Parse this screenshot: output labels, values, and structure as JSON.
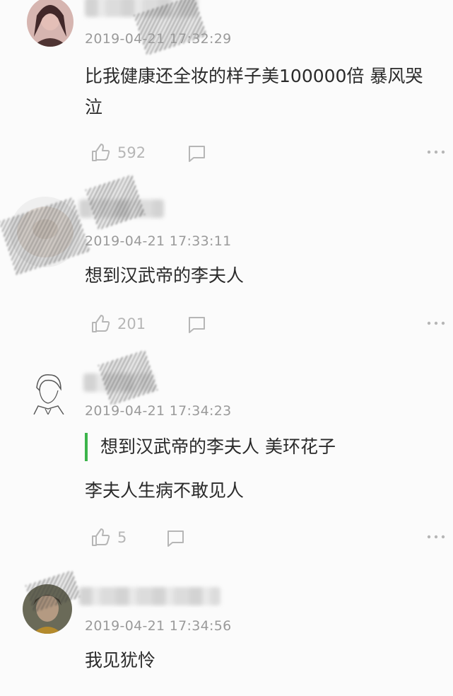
{
  "colors": {
    "background": "#fbfbfb",
    "text": "#2a2a2a",
    "timestamp": "#9a9a9a",
    "action": "#b6b6b6",
    "quote_bar": "#3cb44b"
  },
  "icons": {
    "like": "thumbs-up-icon",
    "reply": "speech-bubble-icon",
    "more": "ellipsis-icon"
  },
  "comments": [
    {
      "timestamp": "2019-04-21 17:32:29",
      "text": "比我健康还全妆的样子美100000倍 暴风哭泣",
      "likes": "592"
    },
    {
      "timestamp": "2019-04-21 17:33:11",
      "text": "想到汉武帝的李夫人",
      "likes": "201"
    },
    {
      "timestamp": "2019-04-21 17:34:23",
      "quote": "想到汉武帝的李夫人 美环花子",
      "text": "李夫人生病不敢见人",
      "likes": "5"
    },
    {
      "timestamp": "2019-04-21 17:34:56",
      "text": "我见犹怜"
    }
  ]
}
